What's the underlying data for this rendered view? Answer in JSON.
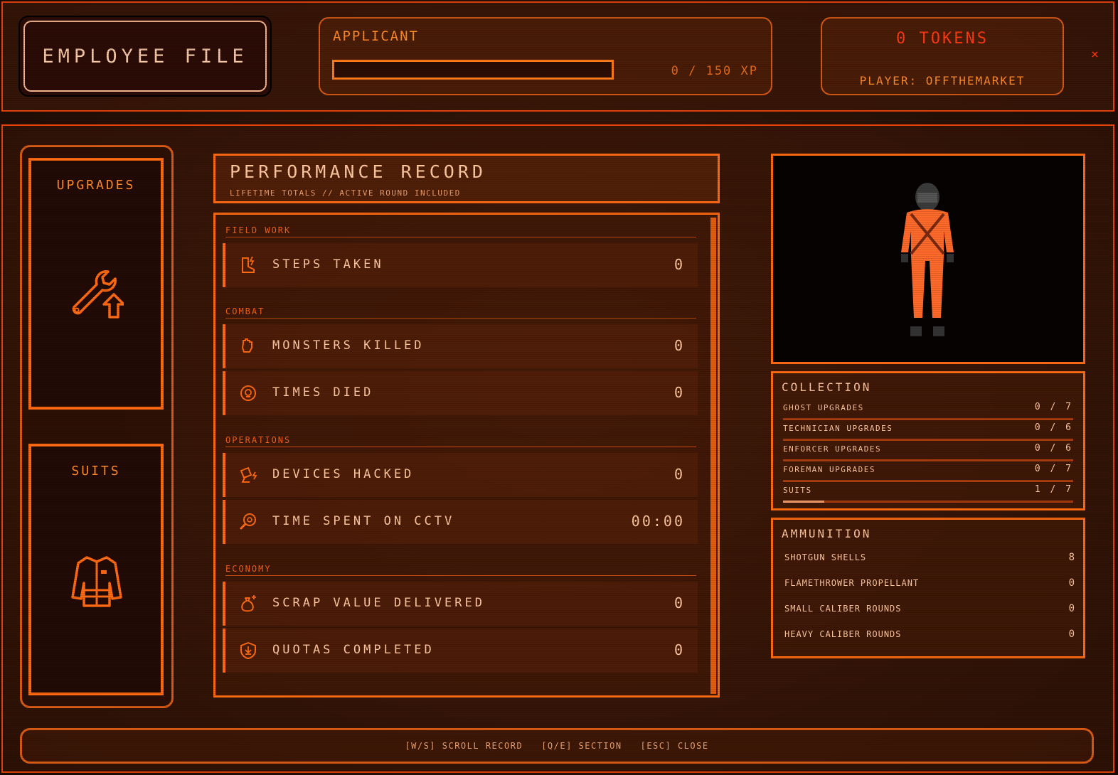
{
  "header": {
    "title": "EMPLOYEE FILE",
    "rank": "APPLICANT",
    "xp_text": "0 / 150 XP",
    "xp_progress": 0,
    "tokens": "0 TOKENS",
    "player": "PLAYER: OFFTHEMARKET",
    "close": "×"
  },
  "sidebar": {
    "upgrades_label": "UPGRADES",
    "suits_label": "SUITS"
  },
  "performance": {
    "title": "PERFORMANCE RECORD",
    "subtitle": "LIFETIME TOTALS // ACTIVE ROUND INCLUDED",
    "sections": [
      {
        "label": "FIELD WORK"
      },
      {
        "label": "COMBAT"
      },
      {
        "label": "OPERATIONS"
      },
      {
        "label": "ECONOMY"
      }
    ],
    "stats": [
      {
        "name": "STEPS TAKEN",
        "value": "0",
        "icon": "boot-icon"
      },
      {
        "name": "MONSTERS KILLED",
        "value": "0",
        "icon": "fist-icon"
      },
      {
        "name": "TIMES DIED",
        "value": "0",
        "icon": "skull-icon"
      },
      {
        "name": "DEVICES HACKED",
        "value": "0",
        "icon": "satellite-icon"
      },
      {
        "name": "TIME SPENT ON CCTV",
        "value": "00:00",
        "icon": "magnifier-icon"
      },
      {
        "name": "SCRAP VALUE DELIVERED",
        "value": "0",
        "icon": "bag-icon"
      },
      {
        "name": "QUOTAS COMPLETED",
        "value": "0",
        "icon": "shield-icon"
      }
    ]
  },
  "collection": {
    "title": "COLLECTION",
    "rows": [
      {
        "name": "GHOST UPGRADES",
        "value": "0 / 7",
        "progress": 0
      },
      {
        "name": "TECHNICIAN UPGRADES",
        "value": "0 / 6",
        "progress": 0
      },
      {
        "name": "ENFORCER UPGRADES",
        "value": "0 / 6",
        "progress": 0
      },
      {
        "name": "FOREMAN UPGRADES",
        "value": "0 / 7",
        "progress": 0
      },
      {
        "name": "SUITS",
        "value": "1 / 7",
        "progress": 0.143
      }
    ]
  },
  "ammunition": {
    "title": "AMMUNITION",
    "rows": [
      {
        "name": "SHOTGUN SHELLS",
        "value": "8"
      },
      {
        "name": "FLAMETHROWER PROPELLANT",
        "value": "0"
      },
      {
        "name": "SMALL CALIBER ROUNDS",
        "value": "0"
      },
      {
        "name": "HEAVY CALIBER ROUNDS",
        "value": "0"
      }
    ]
  },
  "footer": {
    "scroll": "[W/S] SCROLL RECORD",
    "section": "[Q/E] SECTION",
    "close": "[ESC] CLOSE"
  },
  "colors": {
    "accent": "#ff6a12",
    "text": "#ffc8a0",
    "alert": "#ff3a12",
    "background": "#2a1207"
  }
}
